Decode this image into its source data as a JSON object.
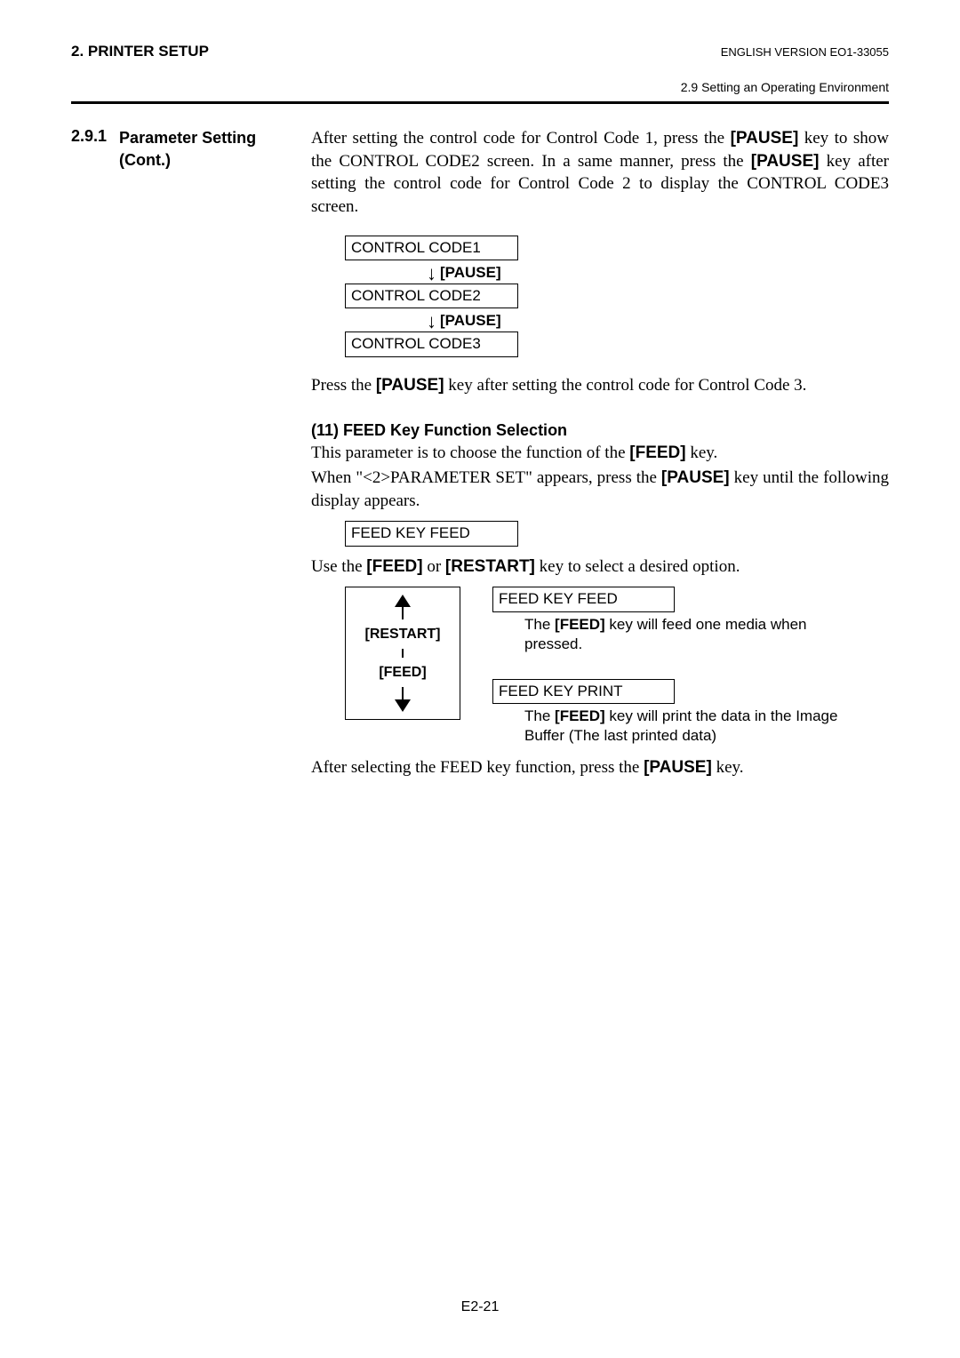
{
  "header": {
    "chapter": "2. PRINTER SETUP",
    "version": "ENGLISH VERSION EO1-33055",
    "section_path": "2.9 Setting an Operating Environment"
  },
  "section": {
    "number": "2.9.1",
    "title": "Parameter Setting (Cont.)"
  },
  "p1_a": "After setting the control code for Control Code 1, press the ",
  "p1_key1": "[PAUSE]",
  "p1_b": " key to show the CONTROL CODE2 screen.  In a same manner, press the ",
  "p1_key2": "[PAUSE]",
  "p1_c": " key after setting the control code for Control Code 2 to display the CONTROL CODE3 screen.",
  "flow": {
    "box1": "CONTROL CODE1",
    "step1": "[PAUSE]",
    "box2": "CONTROL CODE2",
    "step2": "[PAUSE]",
    "box3": "CONTROL CODE3"
  },
  "p2_a": "Press the ",
  "p2_key": "[PAUSE]",
  "p2_b": " key after setting the control code for Control Code 3.",
  "sub": {
    "title": "(11)   FEED Key Function Selection"
  },
  "p3_a": "This parameter is to choose the function of the ",
  "p3_key": "[FEED]",
  "p3_b": " key.",
  "p4_a": "When \"<2>PARAMETER SET\" appears, press the ",
  "p4_key": "[PAUSE]",
  "p4_b": " key until the following display appears.",
  "box_feed": "FEED KEY   FEED",
  "p5_a": "Use the ",
  "p5_key1": "[FEED]",
  "p5_b": " or ",
  "p5_key2": "[RESTART]",
  "p5_c": " key to select a desired option.",
  "nav": {
    "restart": "[RESTART]",
    "feed": "[FEED]"
  },
  "opt1": {
    "box": "FEED KEY   FEED",
    "desc_a": "The ",
    "desc_key": "[FEED]",
    "desc_b": " key will feed one media when pressed."
  },
  "opt2": {
    "box": "FEED KEY   PRINT",
    "desc_a": "The ",
    "desc_key": "[FEED]",
    "desc_b": " key will print the data in the Image Buffer (The last printed data)"
  },
  "p6_a": "After selecting the FEED key function, press the ",
  "p6_key": "[PAUSE]",
  "p6_b": " key.",
  "footer": {
    "page": "E2-21"
  }
}
